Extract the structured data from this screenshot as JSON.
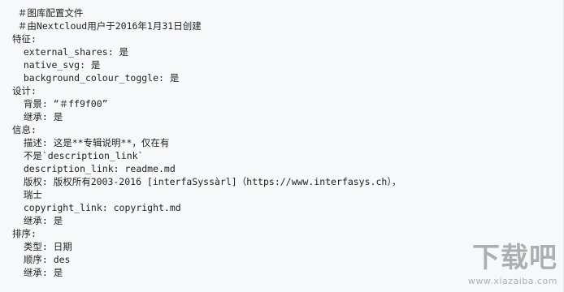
{
  "document": {
    "lines": [
      " ＃图库配置文件",
      " ＃由Nextcloud用户于2016年1月31日创建",
      "特征:",
      "  external_shares: 是",
      "  native_svg: 是",
      "  background_colour_toggle: 是",
      "设计:",
      "  背景: “＃ff9f00”",
      "  继承: 是",
      "信息:",
      "  描述: 这是**专辑说明**，仅在有",
      "  不是`description_link`",
      "  description_link: readme.md",
      "  版权: 版权所有2003-2016 [interfaSyssàrl]（https://www.interfasys.ch），",
      "  瑞士",
      "  copyright_link: copyright.md",
      "  继承: 是",
      "排序:",
      "  类型: 日期",
      "  顺序: des",
      "  继承: 是"
    ]
  },
  "watermark": {
    "glyphs": "下载吧",
    "caption": "www.xiazaiba.com"
  },
  "colors": {
    "background": "#f6f8fa",
    "text": "#1f1f1f"
  }
}
